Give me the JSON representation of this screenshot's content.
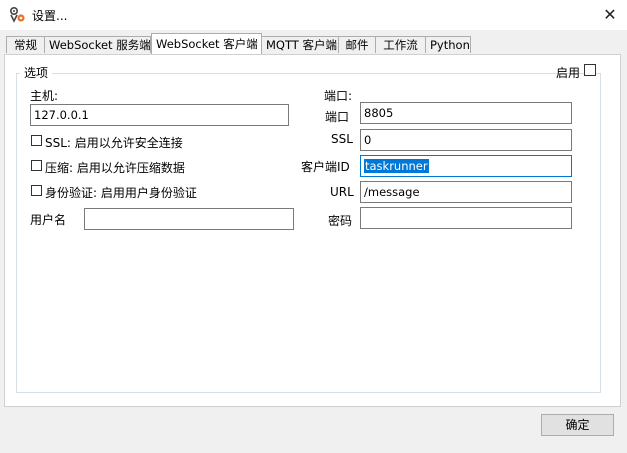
{
  "window": {
    "title": "设置...",
    "close_glyph": "✕"
  },
  "tabs": [
    {
      "label": "常规"
    },
    {
      "label": "WebSocket 服务端"
    },
    {
      "label": "WebSocket 客户端",
      "active": true
    },
    {
      "label": "MQTT 客户端"
    },
    {
      "label": "邮件"
    },
    {
      "label": "工作流"
    },
    {
      "label": "Python"
    }
  ],
  "group": {
    "title": "选项",
    "enable_label": "启用",
    "enabled": false
  },
  "left": {
    "host_label": "主机:",
    "host_value": "127.0.0.1",
    "ssl_label": "SSL: 启用以允许安全连接",
    "ssl_checked": false,
    "compress_label": "压缩: 启用以允许压缩数据",
    "compress_checked": false,
    "auth_label": "身份验证: 启用用户身份验证",
    "auth_checked": false,
    "username_label": "用户名",
    "username_value": ""
  },
  "right": {
    "port_header": "端口:",
    "port_label": "端口",
    "port_value": "8805",
    "ssl_label": "SSL",
    "ssl_value": "0",
    "client_id_label": "客户端ID",
    "client_id_value": "taskrunner",
    "url_label": "URL",
    "url_value": "/message",
    "password_label": "密码",
    "password_value": ""
  },
  "footer": {
    "ok_label": "确定"
  },
  "colors": {
    "selection": "#0078d7",
    "icon_accent": "#e8732c"
  }
}
